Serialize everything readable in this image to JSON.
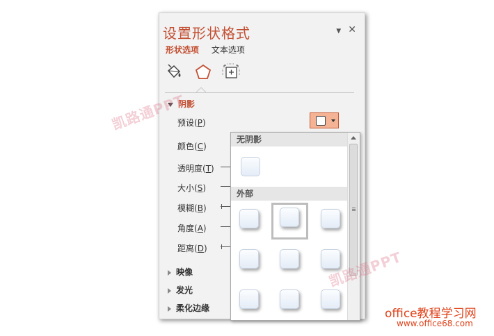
{
  "panel": {
    "title": "设置形状格式",
    "controls": {
      "menu_glyph": "▼",
      "close_glyph": "✕"
    },
    "tabs": [
      {
        "label": "形状选项",
        "active": true
      },
      {
        "label": "文本选项",
        "active": false
      }
    ],
    "icon_tabs": [
      "fill-line-icon",
      "effects-pentagon-icon",
      "size-properties-icon"
    ]
  },
  "shadow_section": {
    "label": "阴影",
    "expanded": true,
    "properties": [
      {
        "label": "预设",
        "key": "P"
      },
      {
        "label": "颜色",
        "key": "C"
      },
      {
        "label": "透明度",
        "key": "T"
      },
      {
        "label": "大小",
        "key": "S"
      },
      {
        "label": "模糊",
        "key": "B"
      },
      {
        "label": "角度",
        "key": "A"
      },
      {
        "label": "距离",
        "key": "D"
      }
    ]
  },
  "collapsed_sections": [
    {
      "label": "映像"
    },
    {
      "label": "发光"
    },
    {
      "label": "柔化边缘"
    }
  ],
  "preset_dropdown": {
    "groups": [
      {
        "label": "无阴影"
      },
      {
        "label": "外部"
      }
    ]
  },
  "watermarks": [
    "凯路通PPT",
    "凯路通PPT"
  ],
  "branding": {
    "line1": "office教程学习网",
    "line2": "www.office68.com"
  },
  "colors": {
    "accent": "#c24f32",
    "preset_button_bg": "#f4b394",
    "brand": "#e0421a"
  }
}
